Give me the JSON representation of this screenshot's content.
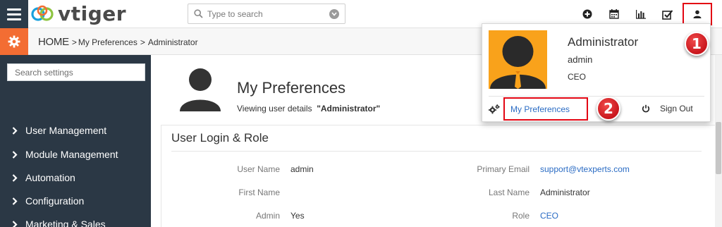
{
  "app": {
    "brand": "vtiger",
    "brand_color": "#f36d33"
  },
  "search": {
    "placeholder": "Type to search"
  },
  "topbar": {
    "icons": [
      "plus-circle-icon",
      "calendar-icon",
      "bar-chart-icon",
      "checkbox-icon",
      "user-icon"
    ]
  },
  "breadcrumb": {
    "home": "HOME",
    "sep1": ">",
    "current_page": "My Preferences",
    "sep2": ">",
    "user": "Administrator"
  },
  "sidebar": {
    "search_placeholder": "Search settings",
    "items": [
      {
        "label": "User Management"
      },
      {
        "label": "Module Management"
      },
      {
        "label": "Automation"
      },
      {
        "label": "Configuration"
      },
      {
        "label": "Marketing & Sales"
      }
    ]
  },
  "main": {
    "title": "My Preferences",
    "subtitle_prefix": "Viewing user details",
    "subtitle_user": "\"Administrator\"",
    "section_title": "User Login & Role",
    "fields": {
      "user_name_label": "User Name",
      "user_name": "admin",
      "primary_email_label": "Primary Email",
      "primary_email": "support@vtexperts.com",
      "first_name_label": "First Name",
      "first_name": "",
      "last_name_label": "Last Name",
      "last_name": "Administrator",
      "admin_label": "Admin",
      "admin": "Yes",
      "role_label": "Role",
      "role": "CEO"
    }
  },
  "user_menu": {
    "name": "Administrator",
    "username": "admin",
    "role": "CEO",
    "preferences_label": "My Preferences",
    "signout_label": "Sign Out"
  },
  "annotations": {
    "marker1": "1",
    "marker2": "2",
    "highlight_color": "#e30613"
  }
}
